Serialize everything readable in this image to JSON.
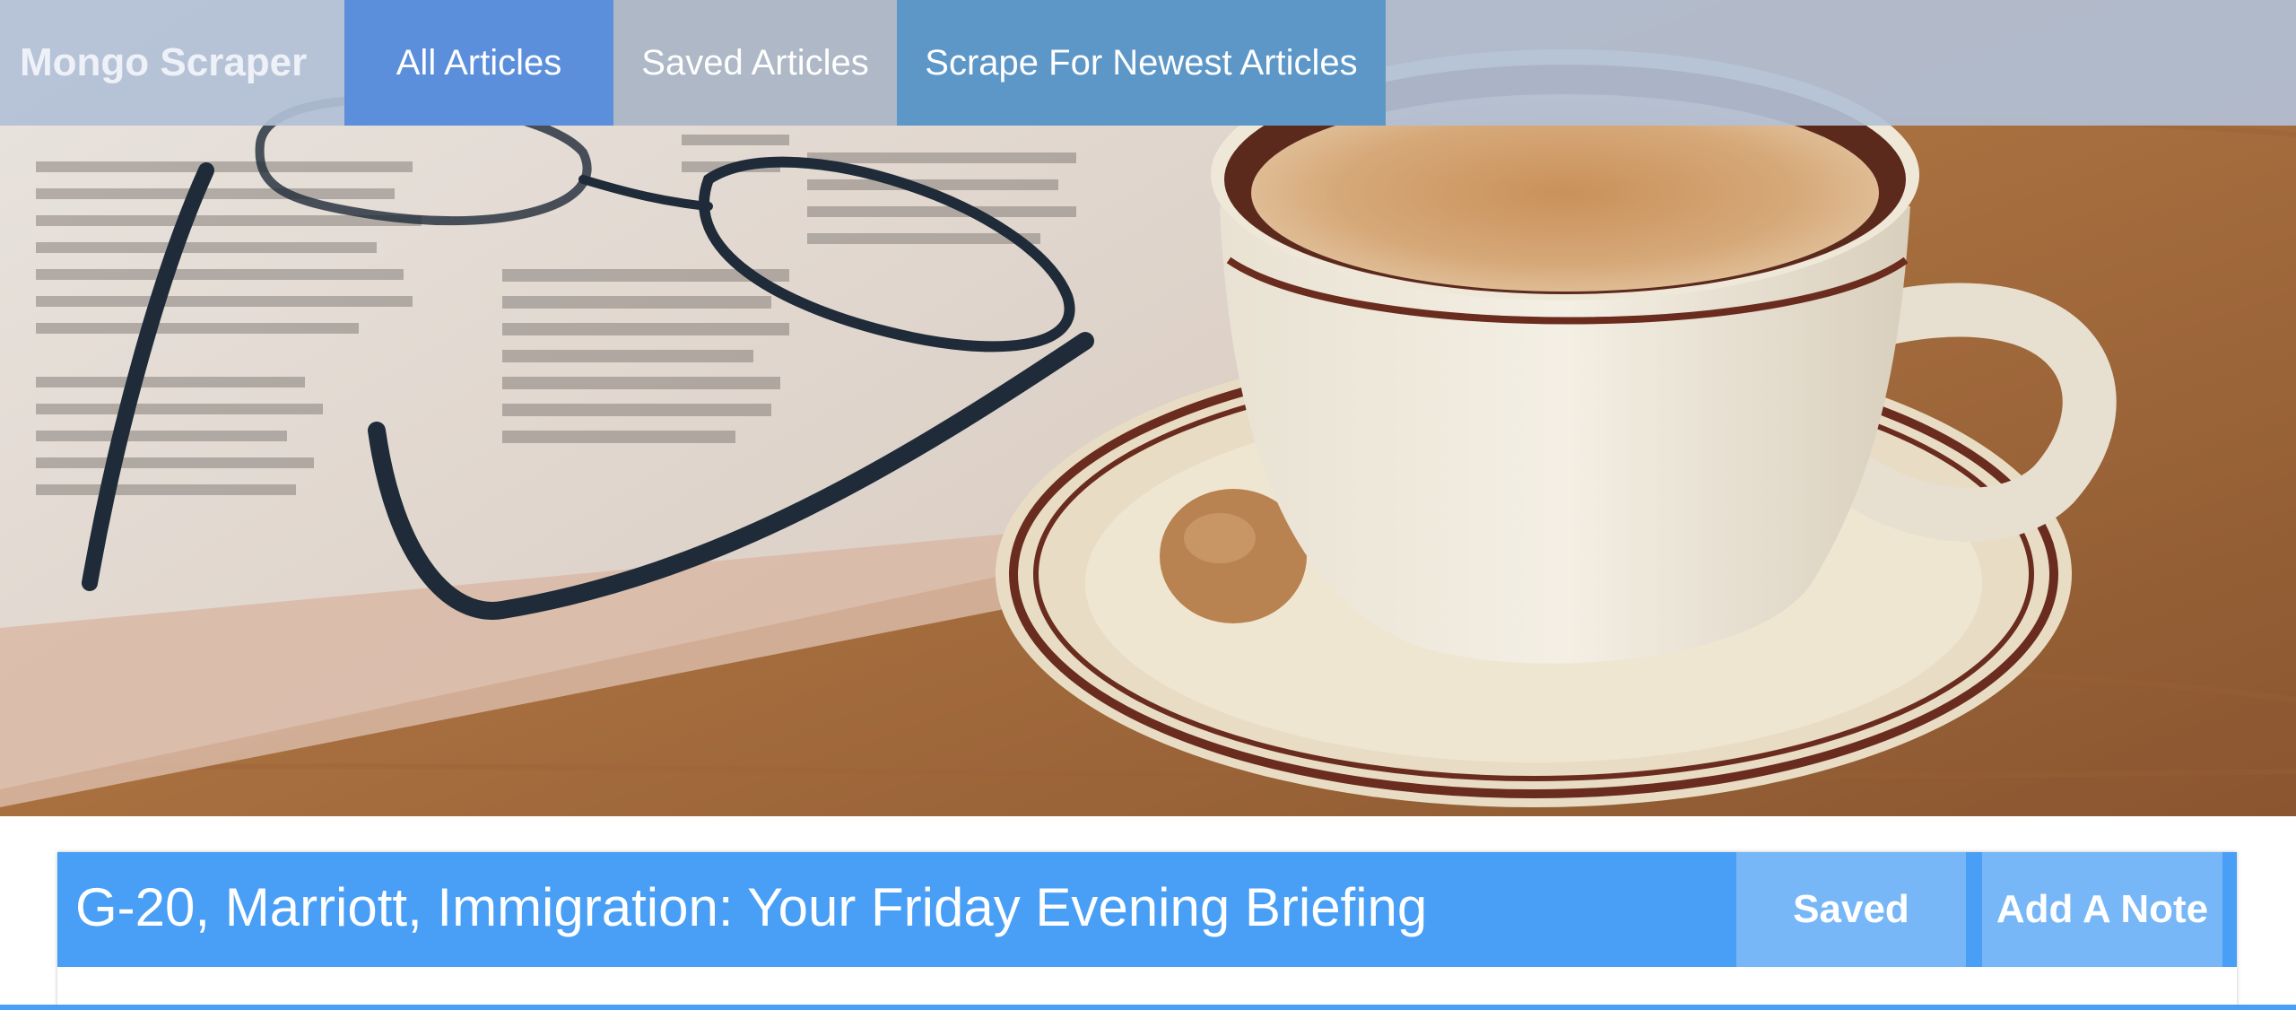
{
  "navbar": {
    "brand": "Mongo Scraper",
    "items": [
      {
        "label": "All Articles",
        "active": true
      },
      {
        "label": "Saved Articles",
        "active": false
      },
      {
        "label": "Scrape For Newest Articles",
        "active": false
      }
    ]
  },
  "hero": {
    "depicts": [
      "newspaper",
      "reading-glasses",
      "coffee-cup",
      "saucer",
      "biscuit",
      "wooden-table"
    ]
  },
  "articles": [
    {
      "title": "G-20, Marriott, Immigration: Your Friday Evening Briefing",
      "saved_label": "Saved",
      "note_label": "Add A Note"
    }
  ],
  "colors": {
    "navbar": "#b2c0d6",
    "nav_active": "#5c8fdb",
    "nav_saved": "#aeb8c6",
    "nav_scrape": "#5d97c8",
    "card_header": "#489ff5",
    "card_button": "#77b7f7"
  }
}
